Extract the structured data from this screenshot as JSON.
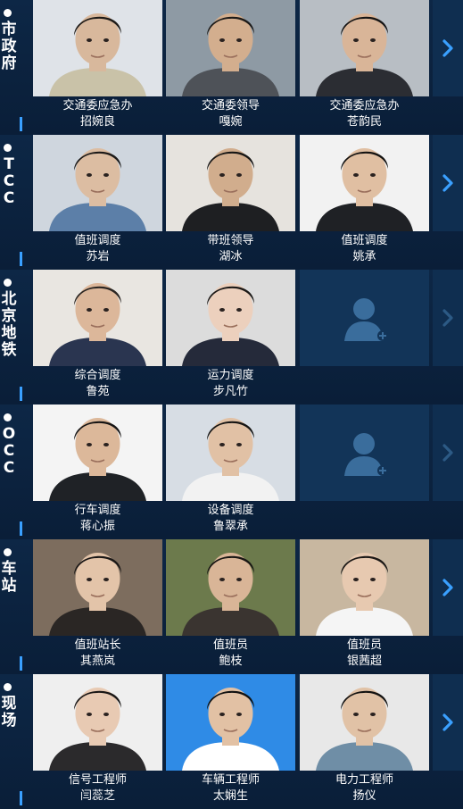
{
  "groups": [
    {
      "label": "市政府",
      "members": [
        {
          "role": "交通委应急办",
          "name": "招婉良",
          "bg": "#dfe3e8",
          "shirt": "#c9c2a8",
          "hair": "#1d1a17",
          "skin": "#d8b89c"
        },
        {
          "role": "交通委领导",
          "name": "嘎婉",
          "bg": "#8e9aa4",
          "shirt": "#4e5258",
          "hair": "#1c1a18",
          "skin": "#d3ae8e"
        },
        {
          "role": "交通委应急办",
          "name": "苍韵民",
          "bg": "#b8bec4",
          "shirt": "#2b2d33",
          "hair": "#151414",
          "skin": "#d9b598"
        }
      ],
      "arrow_active": true
    },
    {
      "label": "TCC",
      "members": [
        {
          "role": "值班调度",
          "name": "苏岩",
          "bg": "#cfd6de",
          "shirt": "#5c7fa8",
          "hair": "#1b1918",
          "skin": "#dcbda2"
        },
        {
          "role": "带班领导",
          "name": "湖冰",
          "bg": "#e6e3de",
          "shirt": "#1e1f22",
          "hair": "#181716",
          "skin": "#d1ad8d"
        },
        {
          "role": "值班调度",
          "name": "姚承",
          "bg": "#f2f2f2",
          "shirt": "#1f2125",
          "hair": "#141312",
          "skin": "#e0bfa2"
        }
      ],
      "arrow_active": true
    },
    {
      "label": "北京地铁",
      "members": [
        {
          "role": "综合调度",
          "name": "鲁苑",
          "bg": "#e9e6e1",
          "shirt": "#2a3550",
          "hair": "#2a2522",
          "skin": "#dcb79a"
        },
        {
          "role": "运力调度",
          "name": "步凡竹",
          "bg": "#dcdcdc",
          "shirt": "#252a3a",
          "hair": "#1c1917",
          "skin": "#ecd0bd"
        }
      ],
      "empty_slot": true,
      "arrow_active": false
    },
    {
      "label": "OCC",
      "members": [
        {
          "role": "行车调度",
          "name": "蒋心振",
          "bg": "#f4f4f4",
          "shirt": "#1f2226",
          "hair": "#151414",
          "skin": "#dcb89a"
        },
        {
          "role": "设备调度",
          "name": "鲁翠承",
          "bg": "#d7dde4",
          "shirt": "#f2f2f2",
          "hair": "#161514",
          "skin": "#e1c1a5"
        }
      ],
      "empty_slot": true,
      "arrow_active": false
    },
    {
      "label": "车站",
      "members": [
        {
          "role": "值班站长",
          "name": "其燕岚",
          "bg": "#7d6d5e",
          "shirt": "#2a2624",
          "hair": "#1a1716",
          "skin": "#e3c4a9"
        },
        {
          "role": "值班员",
          "name": "鲍枝",
          "bg": "#6c7a4c",
          "shirt": "#3a3430",
          "hair": "#191614",
          "skin": "#d9b597"
        },
        {
          "role": "值班员",
          "name": "银茜超",
          "bg": "#c8b7a0",
          "shirt": "#f5f5f5",
          "hair": "#1b1816",
          "skin": "#e7c9b0"
        }
      ],
      "arrow_active": true
    },
    {
      "label": "现场",
      "members": [
        {
          "role": "信号工程师",
          "name": "闫蕊芝",
          "bg": "#efefef",
          "shirt": "#2b2a2c",
          "hair": "#1a1716",
          "skin": "#e8cab3"
        },
        {
          "role": "车辆工程师",
          "name": "太娴生",
          "bg": "#2f8be6",
          "shirt": "#ffffff",
          "hair": "#121212",
          "skin": "#e2c1a4"
        },
        {
          "role": "电力工程师",
          "name": "扬仪",
          "bg": "#e8e8e8",
          "shirt": "#6f8ea6",
          "hair": "#141312",
          "skin": "#e1c2a6"
        }
      ],
      "arrow_active": true
    }
  ],
  "icons": {
    "group_dot": "dot-icon",
    "next": "chevron-right-icon",
    "add_member": "add-user-icon"
  },
  "colors": {
    "background": "#0b1f3a",
    "accent": "#3aa0ff",
    "arrow_active": "#3aa0ff",
    "arrow_inactive": "#2c5a85"
  }
}
